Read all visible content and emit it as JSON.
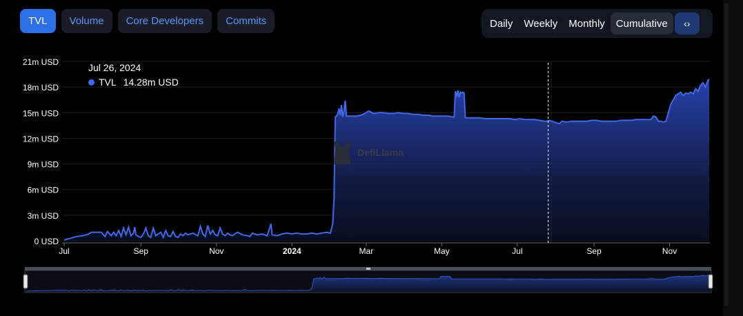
{
  "tabs": [
    {
      "label": "TVL",
      "active": true
    },
    {
      "label": "Volume",
      "active": false
    },
    {
      "label": "Core Developers",
      "active": false
    },
    {
      "label": "Commits",
      "active": false
    }
  ],
  "periods": [
    {
      "label": "Daily",
      "active": false
    },
    {
      "label": "Weekly",
      "active": false
    },
    {
      "label": "Monthly",
      "active": false
    },
    {
      "label": "Cumulative",
      "active": true
    }
  ],
  "embed_icon": "code-icon",
  "tooltip": {
    "date": "Jul 26, 2024",
    "series": "TVL",
    "value": "14.28m USD"
  },
  "watermark": "DefiLlama",
  "colors": {
    "accent": "#2d6fe4",
    "line": "#4169e8",
    "background": "#000000"
  },
  "chart_data": {
    "type": "area",
    "ylabel": "",
    "yticks": [
      "0 USD",
      "3m USD",
      "6m USD",
      "9m USD",
      "12m USD",
      "15m USD",
      "18m USD",
      "21m USD"
    ],
    "ylim": [
      0,
      21
    ],
    "y_unit": "m USD",
    "xticks": [
      {
        "label": "Jul",
        "x": 0
      },
      {
        "label": "Sep",
        "x": 62
      },
      {
        "label": "Nov",
        "x": 123
      },
      {
        "label": "2024",
        "x": 184,
        "bold": true
      },
      {
        "label": "Mar",
        "x": 244
      },
      {
        "label": "May",
        "x": 305
      },
      {
        "label": "Jul",
        "x": 366
      },
      {
        "label": "Sep",
        "x": 428
      },
      {
        "label": "Nov",
        "x": 489
      }
    ],
    "x_unit": "days since 2023-07-01",
    "xlim": [
      0,
      521
    ],
    "grid": true,
    "hover_x": 391,
    "series": [
      {
        "name": "TVL",
        "points": [
          [
            0,
            0.1
          ],
          [
            5,
            0.3
          ],
          [
            10,
            0.5
          ],
          [
            15,
            0.6
          ],
          [
            20,
            0.8
          ],
          [
            22,
            1.0
          ],
          [
            25,
            1.0
          ],
          [
            30,
            1.0
          ],
          [
            33,
            0.5
          ],
          [
            35,
            1.1
          ],
          [
            38,
            0.6
          ],
          [
            40,
            1.0
          ],
          [
            42,
            0.6
          ],
          [
            44,
            1.2
          ],
          [
            46,
            0.5
          ],
          [
            48,
            1.5
          ],
          [
            50,
            0.7
          ],
          [
            52,
            1.6
          ],
          [
            54,
            0.6
          ],
          [
            56,
            0.9
          ],
          [
            57,
            1.6
          ],
          [
            58,
            0.7
          ],
          [
            60,
            0.5
          ],
          [
            62,
            0.4
          ],
          [
            64,
            0.8
          ],
          [
            66,
            1.5
          ],
          [
            68,
            0.6
          ],
          [
            70,
            0.4
          ],
          [
            72,
            1.5
          ],
          [
            74,
            0.6
          ],
          [
            76,
            0.8
          ],
          [
            78,
            1.0
          ],
          [
            80,
            0.4
          ],
          [
            82,
            1.2
          ],
          [
            84,
            0.6
          ],
          [
            86,
            0.5
          ],
          [
            88,
            1.1
          ],
          [
            90,
            0.5
          ],
          [
            92,
            0.4
          ],
          [
            94,
            0.8
          ],
          [
            96,
            0.6
          ],
          [
            98,
            0.9
          ],
          [
            100,
            0.7
          ],
          [
            104,
            0.9
          ],
          [
            108,
            0.6
          ],
          [
            110,
            1.7
          ],
          [
            112,
            0.8
          ],
          [
            114,
            0.5
          ],
          [
            116,
            1.8
          ],
          [
            118,
            0.8
          ],
          [
            120,
            1.2
          ],
          [
            122,
            0.7
          ],
          [
            124,
            0.6
          ],
          [
            126,
            1.5
          ],
          [
            128,
            0.8
          ],
          [
            130,
            0.6
          ],
          [
            132,
            0.9
          ],
          [
            134,
            0.7
          ],
          [
            136,
            0.6
          ],
          [
            138,
            0.8
          ],
          [
            140,
            1.0
          ],
          [
            144,
            0.7
          ],
          [
            148,
            0.6
          ],
          [
            150,
            0.5
          ],
          [
            152,
            0.9
          ],
          [
            156,
            0.7
          ],
          [
            160,
            0.8
          ],
          [
            164,
            0.6
          ],
          [
            166,
            1.5
          ],
          [
            167,
            2.0
          ],
          [
            168,
            0.7
          ],
          [
            172,
            0.6
          ],
          [
            176,
            0.8
          ],
          [
            180,
            0.9
          ],
          [
            184,
            0.8
          ],
          [
            188,
            0.9
          ],
          [
            192,
            0.8
          ],
          [
            196,
            0.8
          ],
          [
            200,
            0.9
          ],
          [
            204,
            0.8
          ],
          [
            208,
            0.9
          ],
          [
            212,
            1.0
          ],
          [
            215,
            0.9
          ],
          [
            217,
            2.0
          ],
          [
            218,
            5.0
          ],
          [
            219,
            14.5
          ],
          [
            220,
            14.6
          ],
          [
            221,
            14.9
          ],
          [
            222,
            15.5
          ],
          [
            223,
            14.7
          ],
          [
            224,
            15.9
          ],
          [
            225,
            14.5
          ],
          [
            226,
            15.2
          ],
          [
            227,
            16.4
          ],
          [
            228,
            14.6
          ],
          [
            232,
            14.6
          ],
          [
            236,
            14.6
          ],
          [
            240,
            14.7
          ],
          [
            244,
            15.0
          ],
          [
            246,
            15.2
          ],
          [
            250,
            14.9
          ],
          [
            254,
            15.0
          ],
          [
            258,
            15.0
          ],
          [
            262,
            14.9
          ],
          [
            266,
            14.9
          ],
          [
            270,
            15.0
          ],
          [
            274,
            14.9
          ],
          [
            278,
            14.9
          ],
          [
            282,
            14.8
          ],
          [
            286,
            14.8
          ],
          [
            290,
            14.7
          ],
          [
            294,
            14.7
          ],
          [
            298,
            14.6
          ],
          [
            302,
            14.6
          ],
          [
            306,
            14.6
          ],
          [
            310,
            14.6
          ],
          [
            314,
            14.5
          ],
          [
            315,
            14.5
          ],
          [
            316,
            17.5
          ],
          [
            317,
            17.0
          ],
          [
            318,
            17.6
          ],
          [
            319,
            16.8
          ],
          [
            320,
            17.4
          ],
          [
            321,
            17.3
          ],
          [
            322,
            17.4
          ],
          [
            323,
            17.3
          ],
          [
            324,
            14.4
          ],
          [
            328,
            14.4
          ],
          [
            332,
            14.4
          ],
          [
            336,
            14.4
          ],
          [
            340,
            14.3
          ],
          [
            344,
            14.3
          ],
          [
            348,
            14.3
          ],
          [
            352,
            14.3
          ],
          [
            356,
            14.3
          ],
          [
            360,
            14.3
          ],
          [
            364,
            14.2
          ],
          [
            368,
            14.3
          ],
          [
            372,
            14.2
          ],
          [
            376,
            14.2
          ],
          [
            380,
            14.2
          ],
          [
            384,
            14.1
          ],
          [
            388,
            14.0
          ],
          [
            390,
            14.0
          ],
          [
            392,
            14.1
          ],
          [
            396,
            13.9
          ],
          [
            400,
            13.7
          ],
          [
            402,
            14.0
          ],
          [
            406,
            13.9
          ],
          [
            410,
            14.0
          ],
          [
            414,
            14.0
          ],
          [
            418,
            14.0
          ],
          [
            422,
            14.0
          ],
          [
            426,
            14.1
          ],
          [
            430,
            14.1
          ],
          [
            434,
            14.0
          ],
          [
            438,
            14.0
          ],
          [
            442,
            14.0
          ],
          [
            446,
            14.0
          ],
          [
            450,
            14.1
          ],
          [
            454,
            14.1
          ],
          [
            458,
            14.1
          ],
          [
            462,
            14.2
          ],
          [
            466,
            14.2
          ],
          [
            470,
            14.2
          ],
          [
            474,
            14.2
          ],
          [
            476,
            14.6
          ],
          [
            478,
            14.5
          ],
          [
            480,
            14.0
          ],
          [
            482,
            14.0
          ],
          [
            484,
            13.9
          ],
          [
            486,
            14.0
          ],
          [
            488,
            15.0
          ],
          [
            490,
            16.0
          ],
          [
            492,
            16.5
          ],
          [
            494,
            17.0
          ],
          [
            496,
            17.2
          ],
          [
            498,
            17.4
          ],
          [
            500,
            17.0
          ],
          [
            502,
            17.3
          ],
          [
            504,
            17.2
          ],
          [
            506,
            17.4
          ],
          [
            508,
            17.2
          ],
          [
            510,
            17.8
          ],
          [
            512,
            17.5
          ],
          [
            514,
            18.2
          ],
          [
            516,
            18.5
          ],
          [
            518,
            18.0
          ],
          [
            520,
            18.8
          ],
          [
            521,
            18.9
          ]
        ]
      }
    ]
  }
}
